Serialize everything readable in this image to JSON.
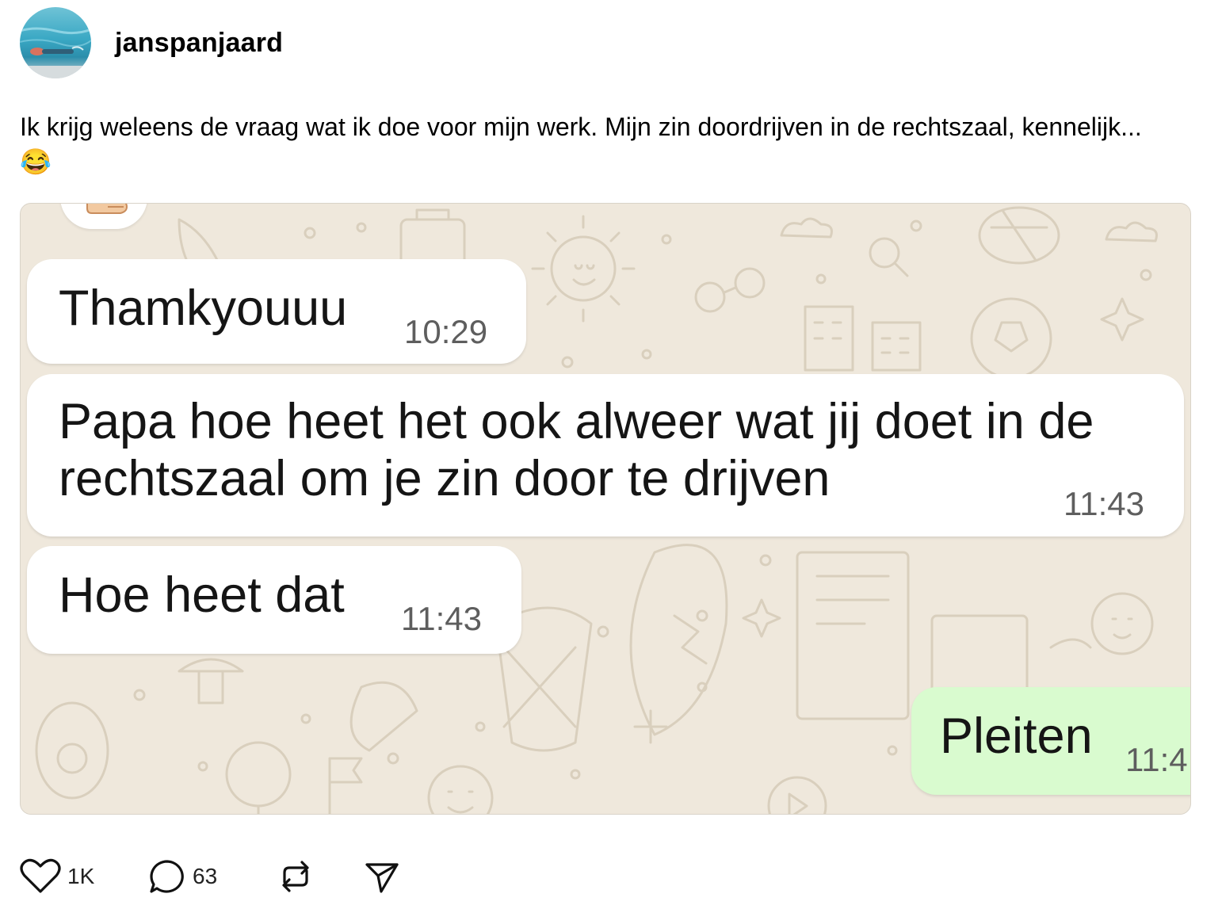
{
  "post": {
    "username": "janspanjaard",
    "caption": "Ik krijg weleens de vraag wat ik doe voor mijn werk. Mijn zin doordrijven in de rechtszaal, kennelijk... 😂",
    "avatar_icon": "swimmer-photo-avatar"
  },
  "chat": {
    "background_color": "#efe8dc",
    "incoming_color": "#ffffff",
    "outgoing_color": "#d9fbcf",
    "messages": [
      {
        "direction": "incoming",
        "text": "Thamkyouuu",
        "time": "10:29"
      },
      {
        "direction": "incoming",
        "text_line1": "Papa hoe heet het ook alweer wat jij doet in de",
        "text_line2": "rechtszaal om je zin door te drijven",
        "time": "11:43"
      },
      {
        "direction": "incoming",
        "text": "Hoe heet dat",
        "time": "11:43"
      },
      {
        "direction": "outgoing",
        "text": "Pleiten",
        "time": "11:4"
      }
    ]
  },
  "actions": {
    "like_count": "1K",
    "reply_count": "63",
    "icons": [
      "heart-icon",
      "comment-icon",
      "repost-icon",
      "share-icon"
    ]
  }
}
